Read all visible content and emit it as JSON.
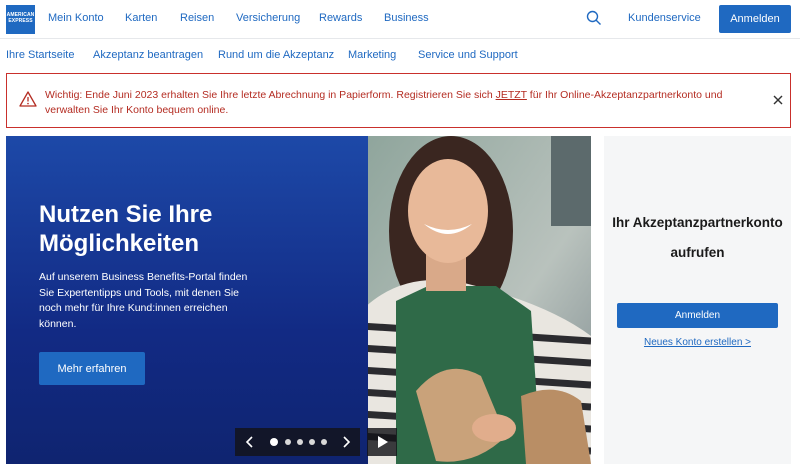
{
  "brand": {
    "logo_lines": [
      "AMERICAN",
      "EXPRESS"
    ],
    "accent": "#1f69c1",
    "alert_color": "#b42c22"
  },
  "topnav": {
    "items": [
      "Mein Konto",
      "Karten",
      "Reisen",
      "Versicherung",
      "Rewards",
      "Business"
    ],
    "search_icon": "search-icon",
    "service_label": "Kundenservice",
    "login_label": "Anmelden"
  },
  "subnav": {
    "items": [
      "Ihre Startseite",
      "Akzeptanz beantragen",
      "Rund um die Akzeptanz",
      "Marketing",
      "Service und Support"
    ]
  },
  "alert": {
    "icon": "warning-icon",
    "text_before": "Wichtig: Ende Juni 2023 erhalten Sie Ihre letzte Abrechnung in Papierform. Registrieren Sie sich ",
    "link_text": "JETZT",
    "text_after": " für Ihr Online-Akzeptanzpartnerkonto und verwalten Sie Ihr Konto bequem online.",
    "close_icon": "close-icon"
  },
  "hero": {
    "title": "Nutzen Sie Ihre Möglichkeiten",
    "description": "Auf unserem Business Benefits-Portal finden Sie Expertentipps und Tools, mit denen Sie noch mehr für Ihre Kund:innen erreichen können.",
    "cta_label": "Mehr erfahren",
    "carousel": {
      "slide_count": 5,
      "active_index": 0,
      "prev_icon": "chevron-left-icon",
      "next_icon": "chevron-right-icon",
      "play_icon": "play-icon"
    }
  },
  "panel": {
    "title": "Ihr Akzeptanzpartnerkonto aufrufen",
    "login_label": "Anmelden",
    "new_account_link": "Neues Konto erstellen >"
  }
}
